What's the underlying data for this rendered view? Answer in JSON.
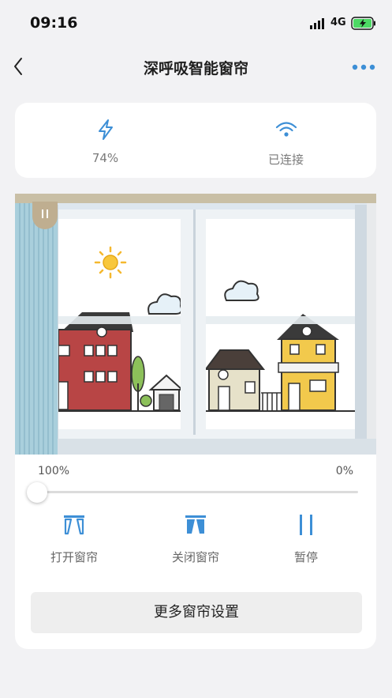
{
  "status_bar": {
    "time": "09:16",
    "network": "4G"
  },
  "nav": {
    "title": "深呼吸智能窗帘"
  },
  "info": {
    "battery_label": "74%",
    "connection_label": "已连接"
  },
  "slider": {
    "left_label": "100%",
    "right_label": "0%",
    "position_fraction": 0.0
  },
  "controls": {
    "open_label": "打开窗帘",
    "close_label": "关闭窗帘",
    "pause_label": "暂停"
  },
  "more_settings_label": "更多窗帘设置",
  "colors": {
    "accent": "#3d8fd6",
    "curtain": "#a9cfdc",
    "valance": "#c9bfa5",
    "pause_tab": "#bfae90"
  },
  "icons": [
    "back-icon",
    "more-icon",
    "lightning-icon",
    "wifi-icon",
    "open-curtain-icon",
    "close-curtain-icon",
    "pause-icon"
  ]
}
